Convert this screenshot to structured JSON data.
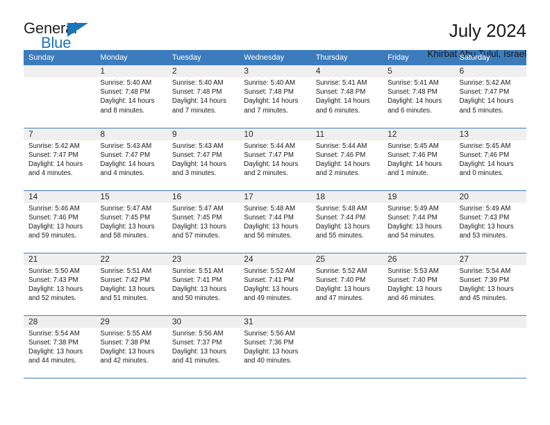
{
  "logo": {
    "word1": "General",
    "word2": "Blue",
    "accent_color": "#1b75bb"
  },
  "header": {
    "title": "July 2024",
    "subtitle": "Khirbat Abu Tulul, Israel"
  },
  "calendar": {
    "header_color": "#3c7cbd",
    "shaded_row_color": "#efefef",
    "weekday_headers": [
      "Sunday",
      "Monday",
      "Tuesday",
      "Wednesday",
      "Thursday",
      "Friday",
      "Saturday"
    ],
    "weeks": [
      [
        {
          "day": "",
          "sunrise": "",
          "sunset": "",
          "daylight": "",
          "empty": true
        },
        {
          "day": "1",
          "sunrise": "Sunrise: 5:40 AM",
          "sunset": "Sunset: 7:48 PM",
          "daylight": "Daylight: 14 hours and 8 minutes."
        },
        {
          "day": "2",
          "sunrise": "Sunrise: 5:40 AM",
          "sunset": "Sunset: 7:48 PM",
          "daylight": "Daylight: 14 hours and 7 minutes."
        },
        {
          "day": "3",
          "sunrise": "Sunrise: 5:40 AM",
          "sunset": "Sunset: 7:48 PM",
          "daylight": "Daylight: 14 hours and 7 minutes."
        },
        {
          "day": "4",
          "sunrise": "Sunrise: 5:41 AM",
          "sunset": "Sunset: 7:48 PM",
          "daylight": "Daylight: 14 hours and 6 minutes."
        },
        {
          "day": "5",
          "sunrise": "Sunrise: 5:41 AM",
          "sunset": "Sunset: 7:48 PM",
          "daylight": "Daylight: 14 hours and 6 minutes."
        },
        {
          "day": "6",
          "sunrise": "Sunrise: 5:42 AM",
          "sunset": "Sunset: 7:47 PM",
          "daylight": "Daylight: 14 hours and 5 minutes."
        }
      ],
      [
        {
          "day": "7",
          "sunrise": "Sunrise: 5:42 AM",
          "sunset": "Sunset: 7:47 PM",
          "daylight": "Daylight: 14 hours and 4 minutes."
        },
        {
          "day": "8",
          "sunrise": "Sunrise: 5:43 AM",
          "sunset": "Sunset: 7:47 PM",
          "daylight": "Daylight: 14 hours and 4 minutes."
        },
        {
          "day": "9",
          "sunrise": "Sunrise: 5:43 AM",
          "sunset": "Sunset: 7:47 PM",
          "daylight": "Daylight: 14 hours and 3 minutes."
        },
        {
          "day": "10",
          "sunrise": "Sunrise: 5:44 AM",
          "sunset": "Sunset: 7:47 PM",
          "daylight": "Daylight: 14 hours and 2 minutes."
        },
        {
          "day": "11",
          "sunrise": "Sunrise: 5:44 AM",
          "sunset": "Sunset: 7:46 PM",
          "daylight": "Daylight: 14 hours and 2 minutes."
        },
        {
          "day": "12",
          "sunrise": "Sunrise: 5:45 AM",
          "sunset": "Sunset: 7:46 PM",
          "daylight": "Daylight: 14 hours and 1 minute."
        },
        {
          "day": "13",
          "sunrise": "Sunrise: 5:45 AM",
          "sunset": "Sunset: 7:46 PM",
          "daylight": "Daylight: 14 hours and 0 minutes."
        }
      ],
      [
        {
          "day": "14",
          "sunrise": "Sunrise: 5:46 AM",
          "sunset": "Sunset: 7:46 PM",
          "daylight": "Daylight: 13 hours and 59 minutes."
        },
        {
          "day": "15",
          "sunrise": "Sunrise: 5:47 AM",
          "sunset": "Sunset: 7:45 PM",
          "daylight": "Daylight: 13 hours and 58 minutes."
        },
        {
          "day": "16",
          "sunrise": "Sunrise: 5:47 AM",
          "sunset": "Sunset: 7:45 PM",
          "daylight": "Daylight: 13 hours and 57 minutes."
        },
        {
          "day": "17",
          "sunrise": "Sunrise: 5:48 AM",
          "sunset": "Sunset: 7:44 PM",
          "daylight": "Daylight: 13 hours and 56 minutes."
        },
        {
          "day": "18",
          "sunrise": "Sunrise: 5:48 AM",
          "sunset": "Sunset: 7:44 PM",
          "daylight": "Daylight: 13 hours and 55 minutes."
        },
        {
          "day": "19",
          "sunrise": "Sunrise: 5:49 AM",
          "sunset": "Sunset: 7:44 PM",
          "daylight": "Daylight: 13 hours and 54 minutes."
        },
        {
          "day": "20",
          "sunrise": "Sunrise: 5:49 AM",
          "sunset": "Sunset: 7:43 PM",
          "daylight": "Daylight: 13 hours and 53 minutes."
        }
      ],
      [
        {
          "day": "21",
          "sunrise": "Sunrise: 5:50 AM",
          "sunset": "Sunset: 7:43 PM",
          "daylight": "Daylight: 13 hours and 52 minutes."
        },
        {
          "day": "22",
          "sunrise": "Sunrise: 5:51 AM",
          "sunset": "Sunset: 7:42 PM",
          "daylight": "Daylight: 13 hours and 51 minutes."
        },
        {
          "day": "23",
          "sunrise": "Sunrise: 5:51 AM",
          "sunset": "Sunset: 7:41 PM",
          "daylight": "Daylight: 13 hours and 50 minutes."
        },
        {
          "day": "24",
          "sunrise": "Sunrise: 5:52 AM",
          "sunset": "Sunset: 7:41 PM",
          "daylight": "Daylight: 13 hours and 49 minutes."
        },
        {
          "day": "25",
          "sunrise": "Sunrise: 5:52 AM",
          "sunset": "Sunset: 7:40 PM",
          "daylight": "Daylight: 13 hours and 47 minutes."
        },
        {
          "day": "26",
          "sunrise": "Sunrise: 5:53 AM",
          "sunset": "Sunset: 7:40 PM",
          "daylight": "Daylight: 13 hours and 46 minutes."
        },
        {
          "day": "27",
          "sunrise": "Sunrise: 5:54 AM",
          "sunset": "Sunset: 7:39 PM",
          "daylight": "Daylight: 13 hours and 45 minutes."
        }
      ],
      [
        {
          "day": "28",
          "sunrise": "Sunrise: 5:54 AM",
          "sunset": "Sunset: 7:38 PM",
          "daylight": "Daylight: 13 hours and 44 minutes."
        },
        {
          "day": "29",
          "sunrise": "Sunrise: 5:55 AM",
          "sunset": "Sunset: 7:38 PM",
          "daylight": "Daylight: 13 hours and 42 minutes."
        },
        {
          "day": "30",
          "sunrise": "Sunrise: 5:56 AM",
          "sunset": "Sunset: 7:37 PM",
          "daylight": "Daylight: 13 hours and 41 minutes."
        },
        {
          "day": "31",
          "sunrise": "Sunrise: 5:56 AM",
          "sunset": "Sunset: 7:36 PM",
          "daylight": "Daylight: 13 hours and 40 minutes."
        },
        {
          "day": "",
          "sunrise": "",
          "sunset": "",
          "daylight": "",
          "empty": true
        },
        {
          "day": "",
          "sunrise": "",
          "sunset": "",
          "daylight": "",
          "empty": true
        },
        {
          "day": "",
          "sunrise": "",
          "sunset": "",
          "daylight": "",
          "empty": true
        }
      ]
    ]
  }
}
